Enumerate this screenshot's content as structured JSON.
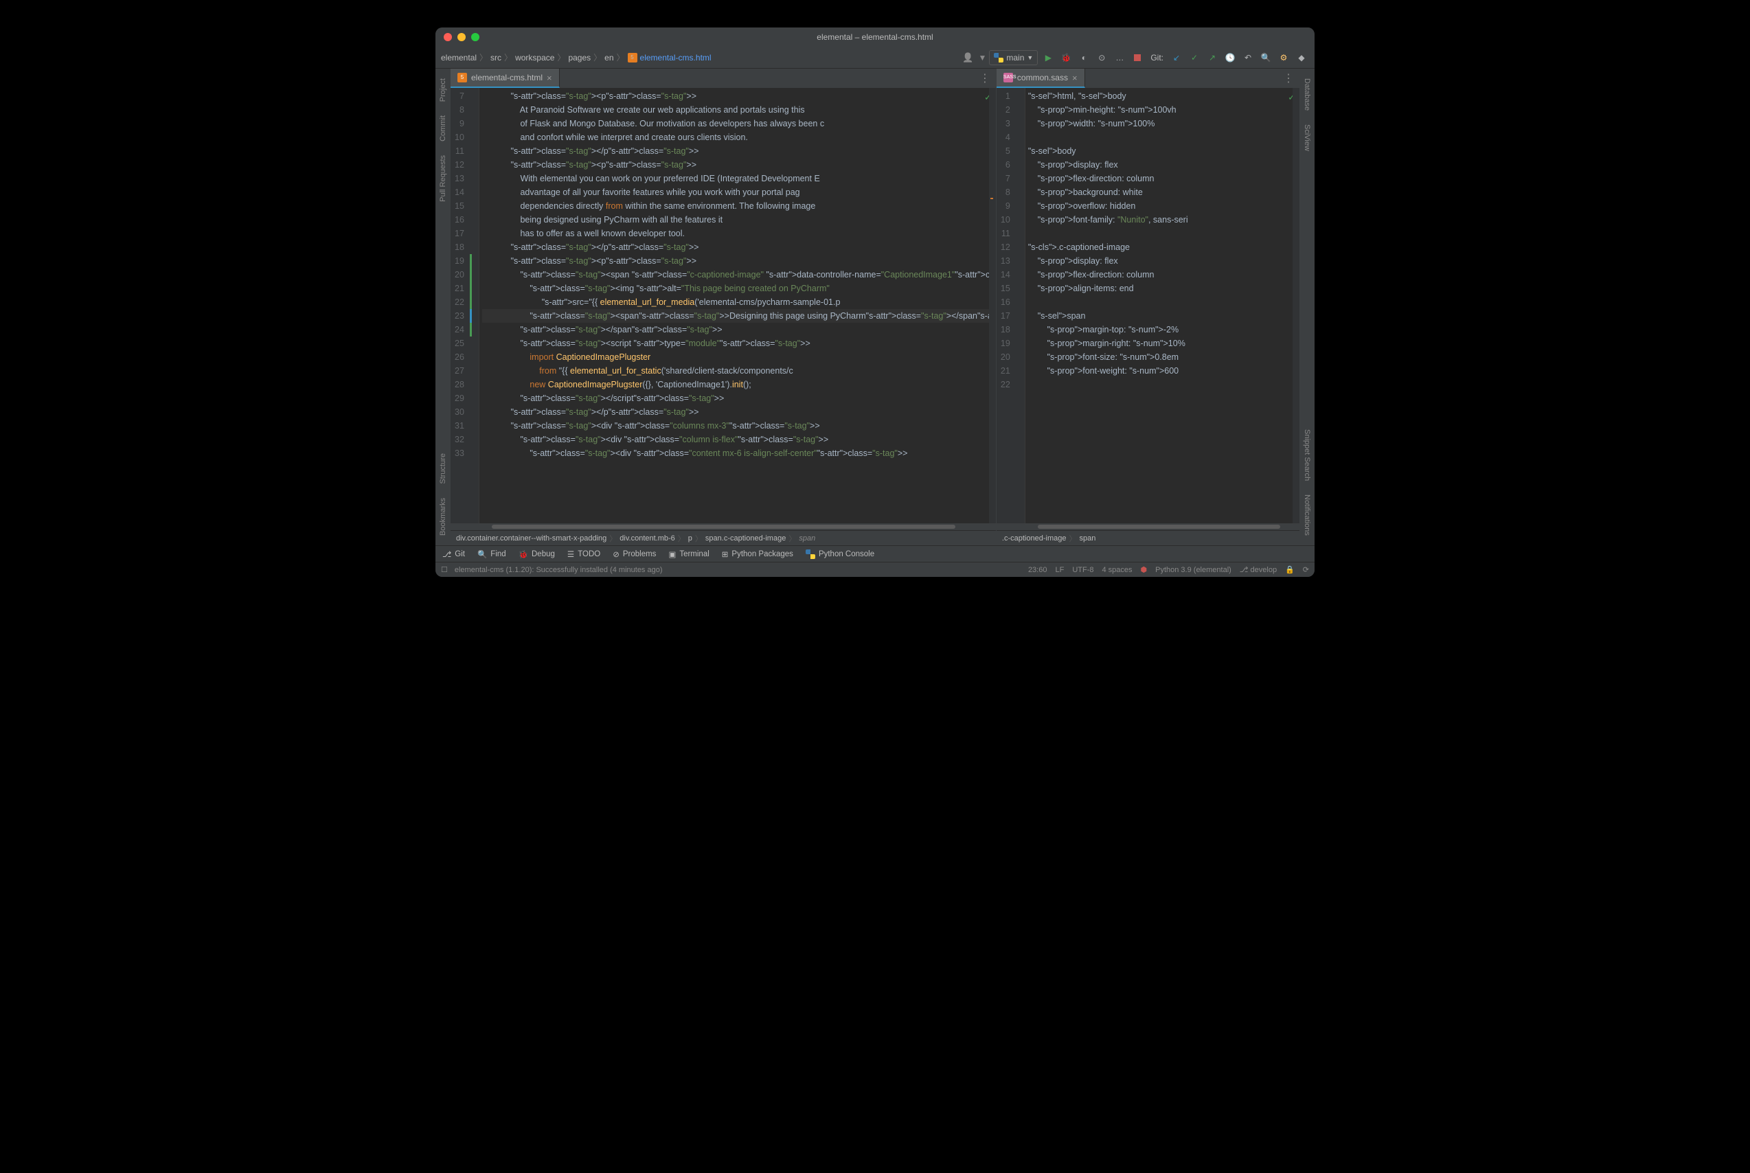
{
  "title": "elemental – elemental-cms.html",
  "breadcrumb": [
    "elemental",
    "src",
    "workspace",
    "pages",
    "en"
  ],
  "breadcrumb_file": "elemental-cms.html",
  "run_config": "main",
  "run_config_dropdown": "▼",
  "git_label": "Git:",
  "left_rail": [
    "Project",
    "Commit",
    "Pull Requests",
    "Structure",
    "Bookmarks"
  ],
  "right_rail": [
    "Database",
    "SciView",
    "Snippet Search",
    "Notifications"
  ],
  "left_tab": "elemental-cms.html",
  "right_tab": "common.sass",
  "left_lines_start": 7,
  "left_lines_end": 33,
  "left_code": [
    "            <p>",
    "                At Paranoid Software we create our web applications and portals using this",
    "                of Flask and Mongo Database. Our motivation as developers has always been c",
    "                and confort while we interpret and create ours clients vision.",
    "            </p>",
    "            <p>",
    "                With elemental you can work on your preferred IDE (Integrated Development E",
    "                advantage of all your favorite features while you work with your portal pag",
    "                dependencies directly from within the same environment. The following image",
    "                being designed using PyCharm with all the features it",
    "                has to offer as a well known developer tool.",
    "            </p>",
    "            <p>",
    "                <span class=\"c-captioned-image\" data-controller-name=\"CaptionedImage1\">",
    "                    <img alt=\"This page being created on PyCharm\"",
    "                         src=\"{{ elemental_url_for_media('elemental-cms/pycharm-sample-01.p",
    "                    <span>Designing this page using PyCharm</span>",
    "                </span>",
    "                <script type=\"module\">",
    "                    import CaptionedImagePlugster",
    "                        from \"{{ elemental_url_for_static('shared/client-stack/components/c",
    "                    new CaptionedImagePlugster({}, 'CaptionedImage1').init();",
    "                </script>",
    "            </p>",
    "            <div class=\"columns mx-3\">",
    "                <div class=\"column is-flex\">",
    "                    <div class=\"content mx-6 is-align-self-center\">"
  ],
  "right_lines_start": 1,
  "right_lines_end": 22,
  "right_code": [
    "html, body",
    "    min-height: 100vh",
    "    width: 100%",
    "",
    "body",
    "    display: flex",
    "    flex-direction: column",
    "    background: white",
    "    overflow: hidden",
    "    font-family: \"Nunito\", sans-seri",
    "",
    ".c-captioned-image",
    "    display: flex",
    "    flex-direction: column",
    "    align-items: end",
    "",
    "    span",
    "        margin-top: -2%",
    "        margin-right: 10%",
    "        font-size: 0.8em",
    "        font-weight: 600",
    ""
  ],
  "crumb_left": [
    "div.container.container--with-smart-x-padding",
    "div.content.mb-6",
    "p",
    "span.c-captioned-image",
    "span"
  ],
  "crumb_right": [
    ".c-captioned-image",
    "span"
  ],
  "bottom_tools": [
    "Git",
    "Find",
    "Debug",
    "TODO",
    "Problems",
    "Terminal",
    "Python Packages",
    "Python Console"
  ],
  "status_msg": "elemental-cms (1.1.20): Successfully installed (4 minutes ago)",
  "status_pos": "23:60",
  "status_le": "LF",
  "status_enc": "UTF-8",
  "status_indent": "4 spaces",
  "status_py": "Python 3.9 (elemental)",
  "status_branch": "develop"
}
